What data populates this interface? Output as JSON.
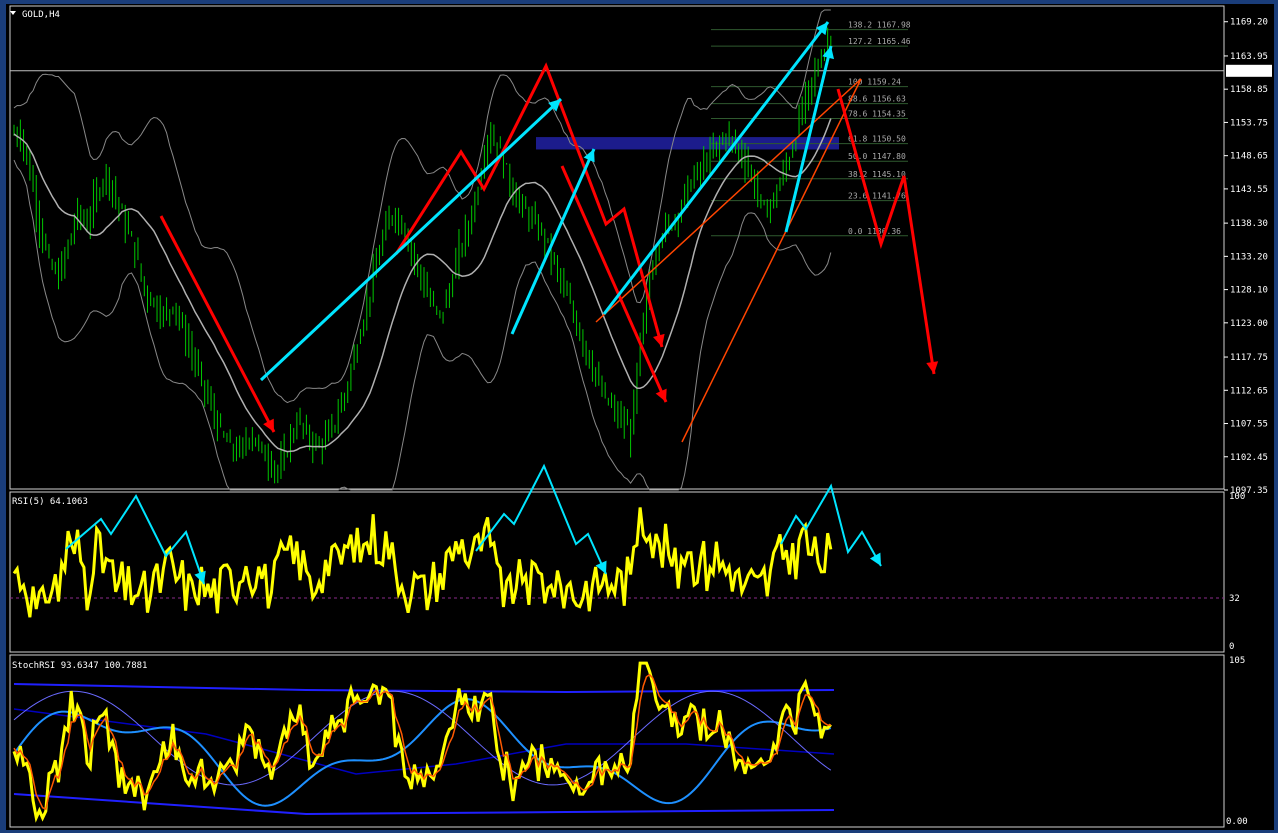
{
  "chart_title": "GOLD,H4",
  "current_price": "1161.67",
  "price_axis_labels": [
    "1169.20",
    "1163.95",
    "1158.85",
    "1153.75",
    "1148.65",
    "1143.55",
    "1138.30",
    "1133.20",
    "1128.10",
    "1123.00",
    "1117.75",
    "1112.65",
    "1107.55",
    "1102.45",
    "1097.35"
  ],
  "fib_levels": [
    {
      "label": "138.2 1167.98"
    },
    {
      "label": "127.2 1165.46"
    },
    {
      "label": "100 1159.24"
    },
    {
      "label": "88.6 1156.63"
    },
    {
      "label": "78.6 1154.35"
    },
    {
      "label": "61.8 1150.50"
    },
    {
      "label": "50.0 1147.80"
    },
    {
      "label": "38.2 1145.10"
    },
    {
      "label": "23.6 1141.76"
    },
    {
      "label": "0.0 1136.36"
    }
  ],
  "rsi_panel": {
    "title": "RSI(5) 64.1063",
    "axis_labels": [
      "100",
      "32",
      "0"
    ]
  },
  "stoch_panel": {
    "title": "StochRSI 93.6347 100.7881",
    "axis_labels": [
      "105",
      "0.00"
    ]
  },
  "colors": {
    "bull": "#00c800",
    "rsi": "#ffff00",
    "arrow_red": "#ff0000",
    "arrow_cyan": "#00e5ff",
    "fib_zone": "#1c1c8c",
    "bollinger": "#888888"
  },
  "chart_data": {
    "type": "line",
    "title": "GOLD,H4",
    "ylim": [
      1097.35,
      1171.0
    ],
    "close_series": [
      1152,
      1146,
      1138,
      1132,
      1130,
      1135,
      1140,
      1138,
      1143,
      1146,
      1142,
      1138,
      1134,
      1128,
      1126,
      1124,
      1126,
      1122,
      1118,
      1114,
      1110,
      1106,
      1104,
      1103,
      1106,
      1104,
      1102,
      1100,
      1104,
      1108,
      1106,
      1104,
      1105,
      1108,
      1112,
      1118,
      1124,
      1130,
      1136,
      1140,
      1138,
      1134,
      1130,
      1126,
      1124,
      1128,
      1134,
      1138,
      1144,
      1152,
      1150,
      1146,
      1142,
      1140,
      1138,
      1136,
      1132,
      1128,
      1124,
      1120,
      1116,
      1112,
      1110,
      1108,
      1106,
      1120,
      1130,
      1136,
      1138,
      1140,
      1144,
      1146,
      1148,
      1150,
      1152,
      1150,
      1148,
      1144,
      1140,
      1142,
      1146,
      1150,
      1156,
      1160,
      1164,
      1167
    ]
  }
}
